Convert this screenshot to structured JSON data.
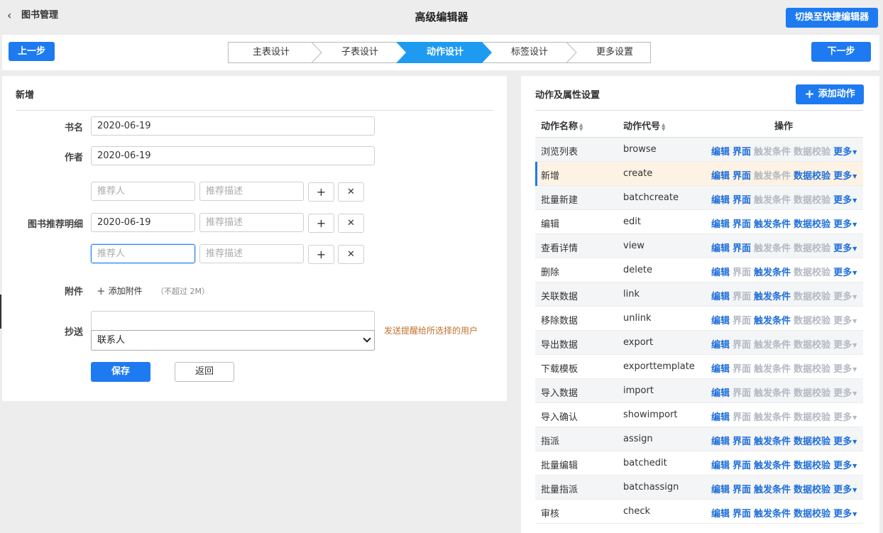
{
  "header": {
    "back_label": "图书管理",
    "title": "高级编辑器",
    "switch_label": "切换至快捷编辑器"
  },
  "steps": {
    "prev_label": "上一步",
    "next_label": "下一步",
    "items": [
      "主表设计",
      "子表设计",
      "动作设计",
      "标签设计",
      "更多设置"
    ],
    "active": "动作设计",
    "active_color": "#1e9bf0"
  },
  "form": {
    "section_title": "新增",
    "book_name": {
      "label": "书名",
      "value": "2020-06-19"
    },
    "author": {
      "label": "作者",
      "value": "2020-06-19"
    },
    "recommend": {
      "label": "图书推荐明细",
      "rows": [
        {
          "person": "",
          "person_placeholder": "推荐人",
          "desc": "",
          "desc_placeholder": "推荐描述"
        },
        {
          "person": "2020-06-19",
          "person_placeholder": "推荐人",
          "desc": "",
          "desc_placeholder": "推荐描述"
        },
        {
          "person": "",
          "person_placeholder": "推荐人",
          "desc": "",
          "desc_placeholder": "推荐描述"
        }
      ]
    },
    "attachment": {
      "label": "附件",
      "add_label": "添加附件",
      "hint": "（不超过 2M）"
    },
    "cc": {
      "label": "抄送",
      "input_value": "",
      "select_value": "联系人",
      "hint": "发送提醒给所选择的用户"
    },
    "save_label": "保存",
    "back_label": "返回"
  },
  "actions": {
    "title": "动作及属性设置",
    "add_label": "添加动作",
    "columns": {
      "name": "动作名称",
      "code": "动作代号",
      "ops": "操作"
    },
    "op_labels": [
      "编辑",
      "界面",
      "触发条件",
      "数据校验",
      "更多"
    ],
    "enabled_color": "#1e6fd9",
    "disabled_color": "#b4b9c2",
    "rows": [
      {
        "name": "浏览列表",
        "code": "browse",
        "enabled": [
          true,
          true,
          false,
          false,
          true
        ]
      },
      {
        "name": "新增",
        "code": "create",
        "enabled": [
          true,
          true,
          false,
          true,
          true
        ],
        "selected": true
      },
      {
        "name": "批量新建",
        "code": "batchcreate",
        "enabled": [
          true,
          true,
          false,
          false,
          true
        ]
      },
      {
        "name": "编辑",
        "code": "edit",
        "enabled": [
          true,
          true,
          true,
          true,
          true
        ]
      },
      {
        "name": "查看详情",
        "code": "view",
        "enabled": [
          true,
          true,
          false,
          false,
          true
        ]
      },
      {
        "name": "删除",
        "code": "delete",
        "enabled": [
          true,
          false,
          true,
          false,
          true
        ]
      },
      {
        "name": "关联数据",
        "code": "link",
        "enabled": [
          true,
          false,
          true,
          false,
          false
        ]
      },
      {
        "name": "移除数据",
        "code": "unlink",
        "enabled": [
          true,
          false,
          true,
          false,
          false
        ]
      },
      {
        "name": "导出数据",
        "code": "export",
        "enabled": [
          true,
          false,
          false,
          false,
          false
        ]
      },
      {
        "name": "下载模板",
        "code": "exporttemplate",
        "enabled": [
          true,
          false,
          false,
          false,
          false
        ]
      },
      {
        "name": "导入数据",
        "code": "import",
        "enabled": [
          true,
          false,
          false,
          false,
          false
        ]
      },
      {
        "name": "导入确认",
        "code": "showimport",
        "enabled": [
          true,
          false,
          false,
          false,
          false
        ]
      },
      {
        "name": "指派",
        "code": "assign",
        "enabled": [
          true,
          true,
          true,
          true,
          true
        ]
      },
      {
        "name": "批量编辑",
        "code": "batchedit",
        "enabled": [
          true,
          true,
          true,
          true,
          true
        ]
      },
      {
        "name": "批量指派",
        "code": "batchassign",
        "enabled": [
          true,
          true,
          true,
          true,
          true
        ]
      },
      {
        "name": "审核",
        "code": "check",
        "enabled": [
          true,
          true,
          true,
          true,
          true
        ]
      }
    ]
  }
}
